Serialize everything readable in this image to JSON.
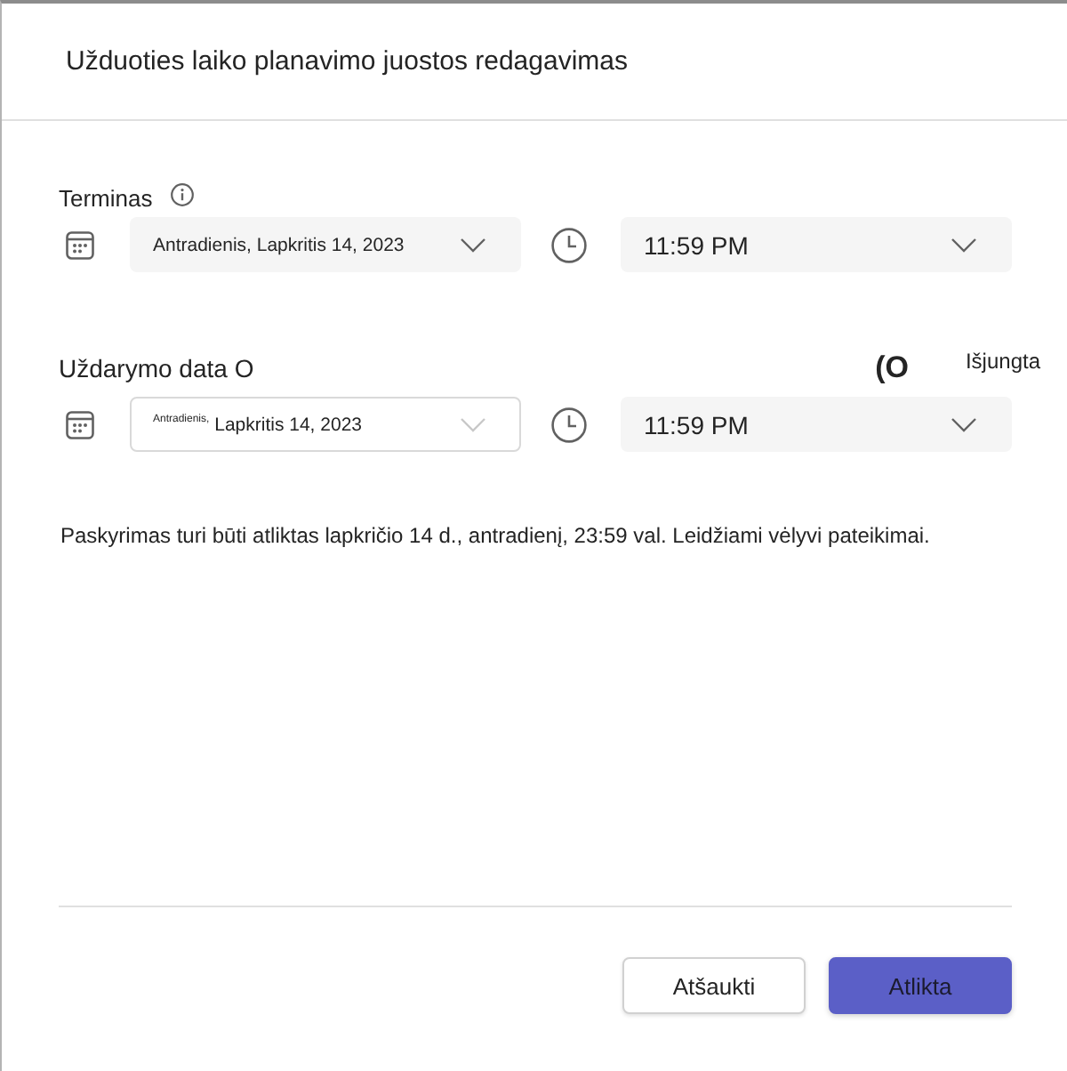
{
  "dialog": {
    "title": "Užduoties laiko planavimo juostos redagavimas"
  },
  "due": {
    "label": "Terminas",
    "date": {
      "value": "Antradienis, Lapkritis 14, 2023",
      "disabled": false
    },
    "time": {
      "value": "11:59 PM",
      "disabled": false
    }
  },
  "closing": {
    "label": "Uždarymo data O",
    "toggle": {
      "glyph": "(O",
      "label": "Išjungta",
      "on": false
    },
    "date": {
      "value": "$^{Antradienis,}$ Lapkritis 14, 2023",
      "disabled": true
    },
    "time": {
      "value": "11:59 PM",
      "disabled": false
    }
  },
  "summary": "Paskyrimas turi būti atliktas lapkričio 14 d., antradienį, 23:59 val. Leidžiami vėlyvi pateikimai.",
  "buttons": [
    {
      "label": "Atšaukti",
      "kind": "secondary"
    },
    {
      "label": "Atlikta",
      "kind": "primary"
    }
  ]
}
